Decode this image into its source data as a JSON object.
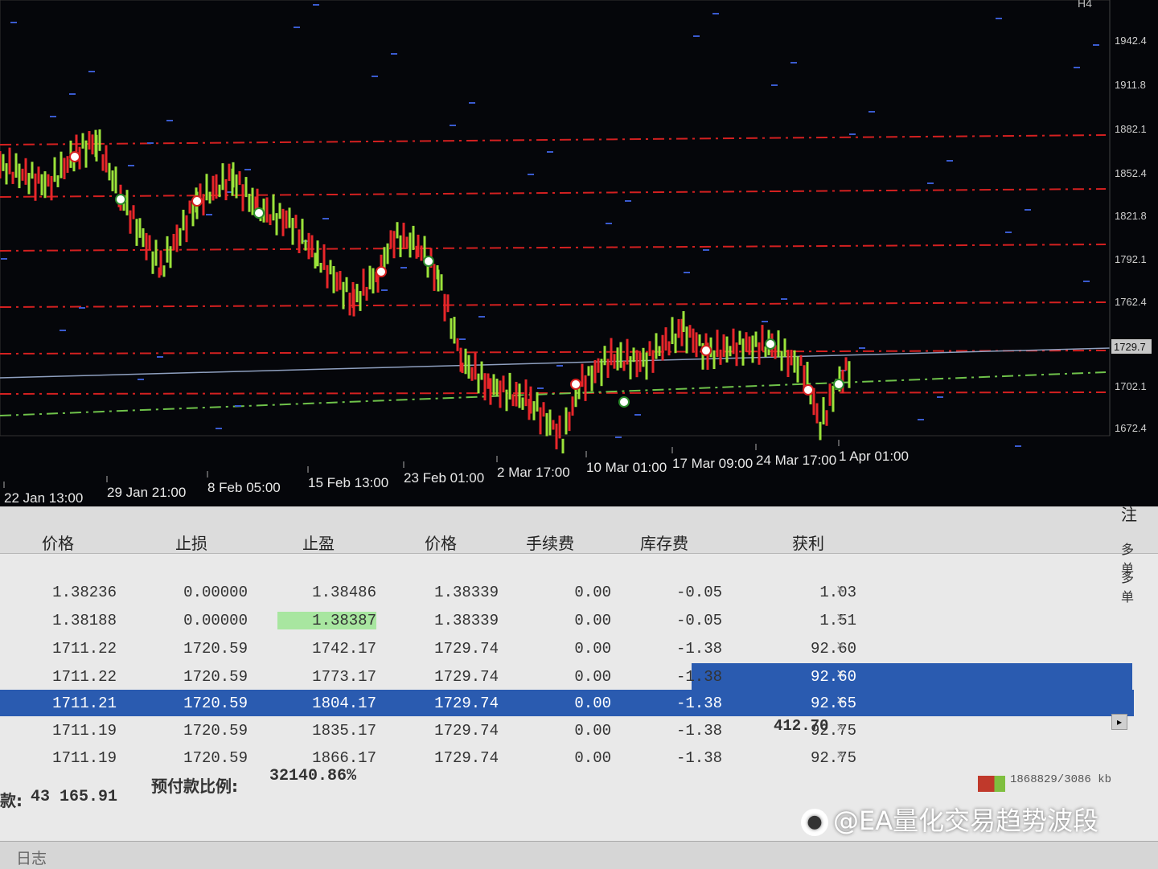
{
  "chart": {
    "title_text": "H4",
    "price_axis": [
      "1942.4",
      "1911.8",
      "1882.1",
      "1852.4",
      "1821.8",
      "1792.1",
      "1762.4",
      "1729.7",
      "1702.1",
      "1672.4"
    ],
    "current_price": "1729.7",
    "time_axis": [
      "22 Jan 13:00",
      "29 Jan 21:00",
      "8 Feb 05:00",
      "15 Feb 13:00",
      "23 Feb 01:00",
      "2 Mar 17:00",
      "10 Mar 01:00",
      "17 Mar 09:00",
      "24 Mar 17:00",
      "1 Apr 01:00"
    ],
    "colors": {
      "bull": "#9be33a",
      "bear": "#e8262a",
      "level_red": "#d42020",
      "level_green": "#6fc24a",
      "price_line": "#8fa0c0"
    }
  },
  "table": {
    "headers": {
      "price": "价格",
      "sl": "止损",
      "tp": "止盈",
      "price2": "价格",
      "commission": "手续费",
      "swap": "库存费",
      "profit": "获利",
      "note": "注"
    },
    "rows": [
      {
        "price": "1.38236",
        "sl": "0.00000",
        "tp": "1.38486",
        "price2": "1.38339",
        "commission": "0.00",
        "swap": "-0.05",
        "profit": "1.03",
        "side": "多单"
      },
      {
        "price": "1.38188",
        "sl": "0.00000",
        "tp": "1.38387",
        "price2": "1.38339",
        "commission": "0.00",
        "swap": "-0.05",
        "profit": "1.51",
        "side": "多单"
      },
      {
        "price": "1711.22",
        "sl": "1720.59",
        "tp": "1742.17",
        "price2": "1729.74",
        "commission": "0.00",
        "swap": "-1.38",
        "profit": "92.60",
        "side": ""
      },
      {
        "price": "1711.22",
        "sl": "1720.59",
        "tp": "1773.17",
        "price2": "1729.74",
        "commission": "0.00",
        "swap": "-1.38",
        "profit": "92.60",
        "side": ""
      },
      {
        "price": "1711.21",
        "sl": "1720.59",
        "tp": "1804.17",
        "price2": "1729.74",
        "commission": "0.00",
        "swap": "-1.38",
        "profit": "92.65",
        "side": ""
      },
      {
        "price": "1711.19",
        "sl": "1720.59",
        "tp": "1835.17",
        "price2": "1729.74",
        "commission": "0.00",
        "swap": "-1.38",
        "profit": "92.75",
        "side": ""
      },
      {
        "price": "1711.19",
        "sl": "1720.59",
        "tp": "1866.17",
        "price2": "1729.74",
        "commission": "0.00",
        "swap": "-1.38",
        "profit": "92.75",
        "side": ""
      }
    ],
    "total_profit": "412.70",
    "close_symbol": "×"
  },
  "footer": {
    "balance_label": "款:",
    "balance_value": "43 165.91",
    "margin_label": "预付款比例:",
    "margin_value": "32140.86%"
  },
  "status": {
    "traffic": "1868829/3086 kb"
  },
  "tabs": {
    "journal": "日志"
  },
  "watermark": "@EA量化交易趋势波段"
}
